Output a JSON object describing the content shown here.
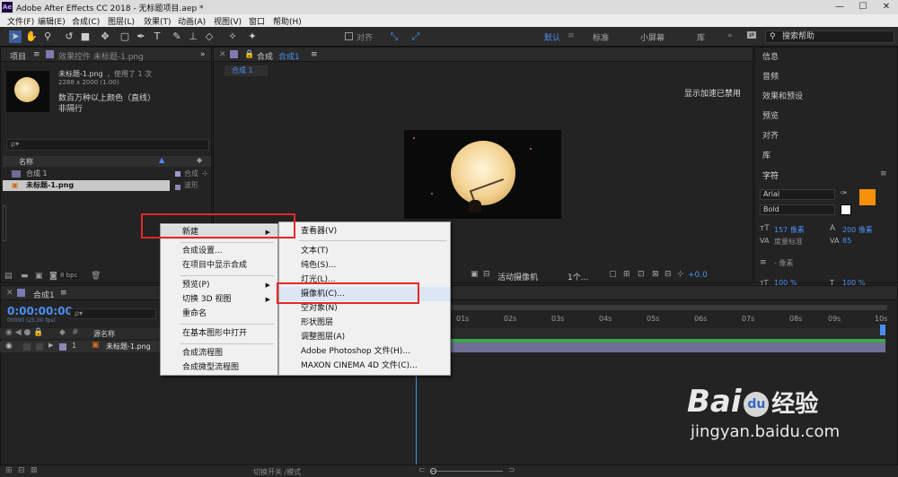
{
  "window": {
    "title": "Adobe After Effects CC 2018 - 无标题项目.aep *",
    "logo": "Ae",
    "minimize": "—",
    "maximize": "☐",
    "close": "✕"
  },
  "menu": [
    "文件(F)",
    "编辑(E)",
    "合成(C)",
    "图层(L)",
    "效果(T)",
    "动画(A)",
    "视图(V)",
    "窗口",
    "帮助(H)"
  ],
  "toolbar": {
    "snap_label": "对齐",
    "workspaces": [
      "默认",
      "标准",
      "小屏幕",
      "库"
    ],
    "search_placeholder": "搜索帮助"
  },
  "project_panel": {
    "tab_project": "项目",
    "tab_effects": "效果控件 未标题-1.png",
    "file_name": "未标题-1.png",
    "file_usage": "，使用了 1 次",
    "file_dims": "2288 x 2000 (1.00)",
    "file_info1": "数百万种以上颜色（直线）",
    "file_info2": "非隔行",
    "search_placeholder": "ρ▾",
    "col_name": "名称",
    "items": [
      {
        "name": "合成 1",
        "type": "合成"
      },
      {
        "name": "未标题-1.png",
        "type": "波形"
      }
    ],
    "bpc": "8 bpc"
  },
  "comp_panel": {
    "tab_label": "合成",
    "comp_name": "合成1",
    "subtab": "合成 1",
    "accel_msg": "显示加速已禁用",
    "camera_label": "活动摄像机",
    "views_label": "1个...",
    "offset": "+0.0"
  },
  "context_menu": {
    "items": [
      {
        "label": "新建",
        "submenu": true
      },
      {
        "label": "合成设置..."
      },
      {
        "label": "在项目中显示合成"
      },
      {
        "label": "预览(P)",
        "submenu": true
      },
      {
        "label": "切换 3D 视图",
        "submenu": true
      },
      {
        "label": "重命名"
      },
      {
        "label": "在基本图形中打开"
      },
      {
        "label": "合成流程图"
      },
      {
        "label": "合成微型流程图"
      }
    ]
  },
  "submenu": {
    "items": [
      "查看器(V)",
      "文本(T)",
      "纯色(S)...",
      "灯光(L)...",
      "摄像机(C)...",
      "空对象(N)",
      "形状图层",
      "调整图层(A)",
      "Adobe Photoshop 文件(H)...",
      "MAXON CINEMA 4D 文件(C)..."
    ]
  },
  "right_panel": {
    "items": [
      "信息",
      "音频",
      "效果和预设",
      "预览",
      "对齐",
      "库"
    ],
    "char_title": "字符",
    "font": "Arial",
    "style": "Bold",
    "size": "157 像素",
    "leading": "200 像素",
    "kern": "度量标准",
    "tracking": "85",
    "stroke": "- 像素",
    "scale_v": "100 %",
    "scale_h": "100 %"
  },
  "timeline": {
    "tab_label": "合成1",
    "timecode": "0:00:00:00",
    "fps_info": "00000 (25.00 fps)",
    "col_source": "源名称",
    "layer_num": "1",
    "layer_name": "未标题-1.png",
    "ticks": [
      "01s",
      "02s",
      "03s",
      "04s",
      "05s",
      "06s",
      "07s",
      "08s",
      "09s",
      "10s"
    ],
    "toggle_label": "切换开关 /模式"
  },
  "watermark": {
    "brand": "Bai",
    "paw": "du",
    "cn": "经验",
    "url": "jingyan.baidu.com"
  },
  "colors": {
    "accent": "#4a8ff0",
    "highlight_red": "#e5282a",
    "swatch_orange": "#f5900a"
  }
}
